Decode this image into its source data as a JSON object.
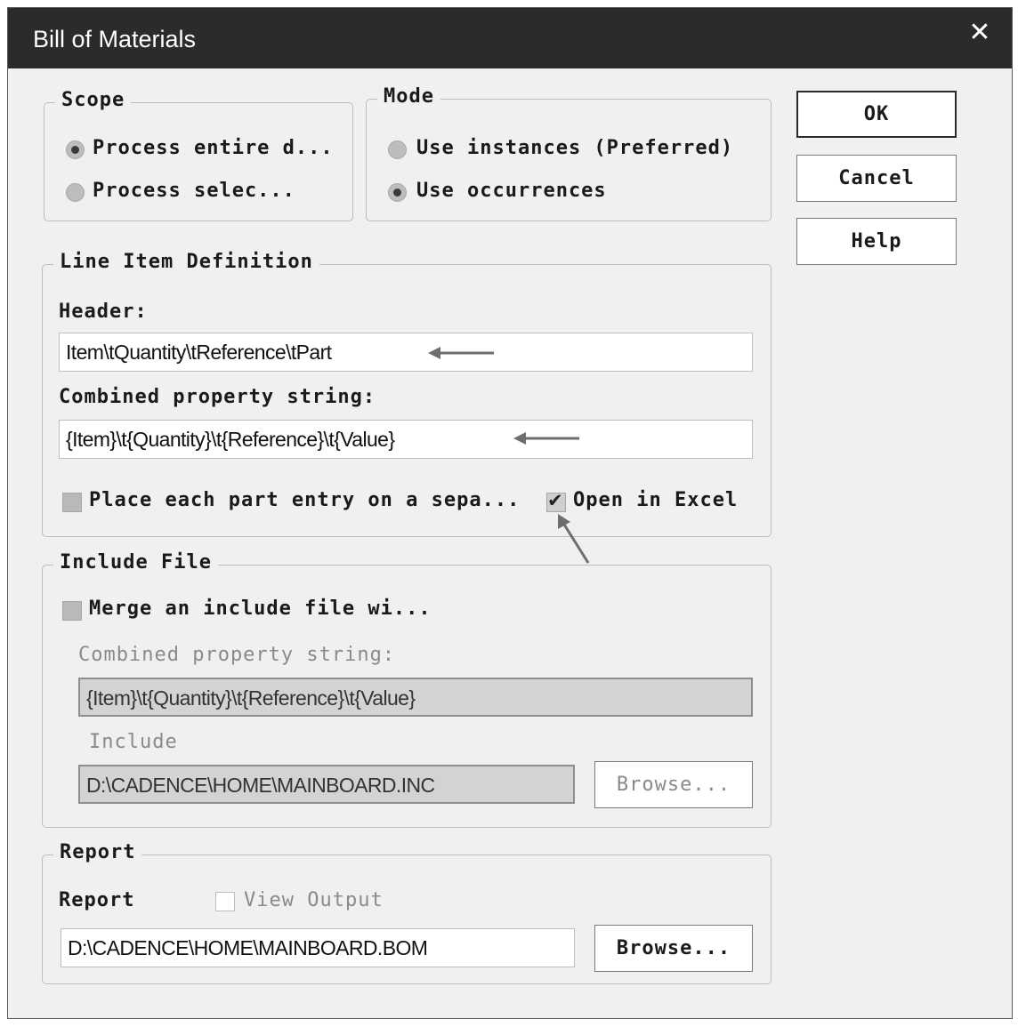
{
  "window": {
    "title": "Bill of Materials",
    "close_glyph": "✕"
  },
  "scope": {
    "legend": "Scope",
    "options": [
      {
        "label": "Process entire d...",
        "selected": true
      },
      {
        "label": "Process selec...",
        "selected": false
      }
    ]
  },
  "mode": {
    "legend": "Mode",
    "options": [
      {
        "label": "Use instances (Preferred)",
        "selected": false
      },
      {
        "label": "Use occurrences",
        "selected": true
      }
    ]
  },
  "buttons": {
    "ok": "OK",
    "cancel": "Cancel",
    "help": "Help"
  },
  "line_item": {
    "legend": "Line Item Definition",
    "header_label": "Header:",
    "header_value": "Item\\tQuantity\\tReference\\tPart",
    "combined_label": "Combined property string:",
    "combined_value": "{Item}\\t{Quantity}\\t{Reference}\\t{Value}",
    "place_each_label": "Place each part entry on a sepa...",
    "place_each_checked": false,
    "open_excel_label": "Open in Excel",
    "open_excel_checked": true,
    "check_glyph": "✔"
  },
  "include_file": {
    "legend": "Include File",
    "merge_label": "Merge an include file wi...",
    "merge_checked": false,
    "combined_label": "Combined property string:",
    "combined_value": "{Item}\\t{Quantity}\\t{Reference}\\t{Value}",
    "include_label": "Include",
    "include_path": "D:\\CADENCE\\HOME\\MAINBOARD.INC",
    "browse_label": "Browse..."
  },
  "report": {
    "legend": "Report",
    "report_label": "Report",
    "view_output_label": "View Output",
    "view_output_checked": false,
    "report_path": "D:\\CADENCE\\HOME\\MAINBOARD.BOM",
    "browse_label": "Browse..."
  },
  "colors": {
    "titlebar": "#2b2b2b",
    "dialog_bg": "#f0f0f0",
    "annotation_arrow": "#6e6e6e"
  }
}
